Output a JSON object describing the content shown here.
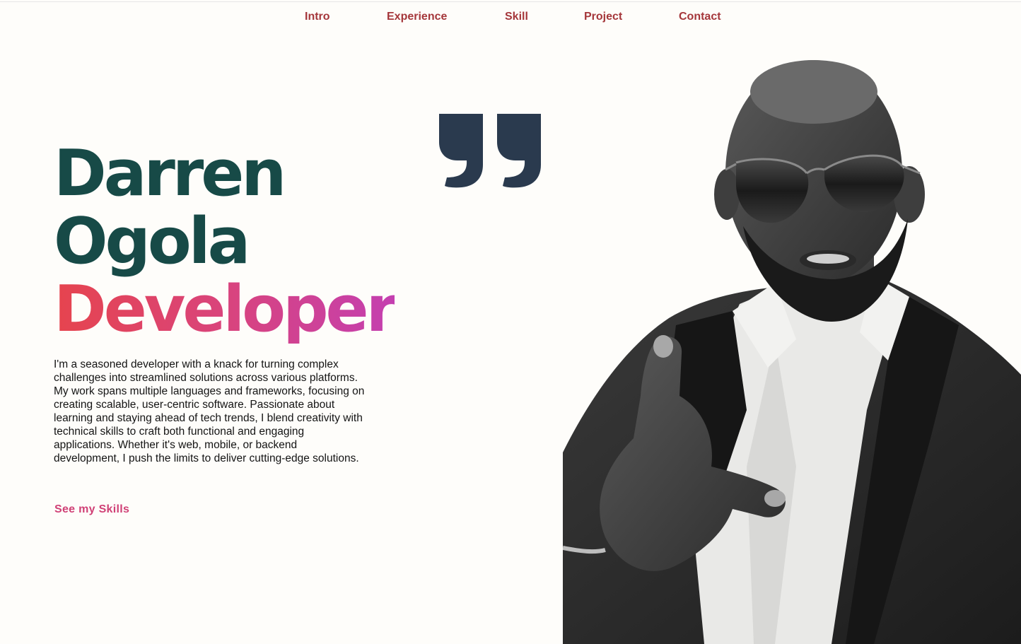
{
  "nav": {
    "items": [
      {
        "label": "Intro"
      },
      {
        "label": "Experience"
      },
      {
        "label": "Skill"
      },
      {
        "label": "Project"
      },
      {
        "label": "Contact"
      }
    ]
  },
  "hero": {
    "first_name": "Darren",
    "last_name": "Ogola",
    "role": "Developer",
    "bio": "I'm a seasoned developer with a knack for turning complex challenges into streamlined solutions across various platforms. My work spans multiple languages and frameworks, focusing on creating scalable, user-centric software. Passionate about learning and staying ahead of tech trends, I blend creativity with technical skills to craft both functional and engaging applications. Whether it's web, mobile, or backend development, I push the limits to deliver cutting-edge solutions.",
    "cta_label": "See my Skills"
  },
  "quote_icon": "closing-quote-icon",
  "colors": {
    "background": "#fefdfa",
    "nav_link": "#a5373b",
    "name": "#174a47",
    "gradient_start": "#e6444e",
    "gradient_end": "#c43fb0",
    "quote": "#2a3a4e"
  }
}
